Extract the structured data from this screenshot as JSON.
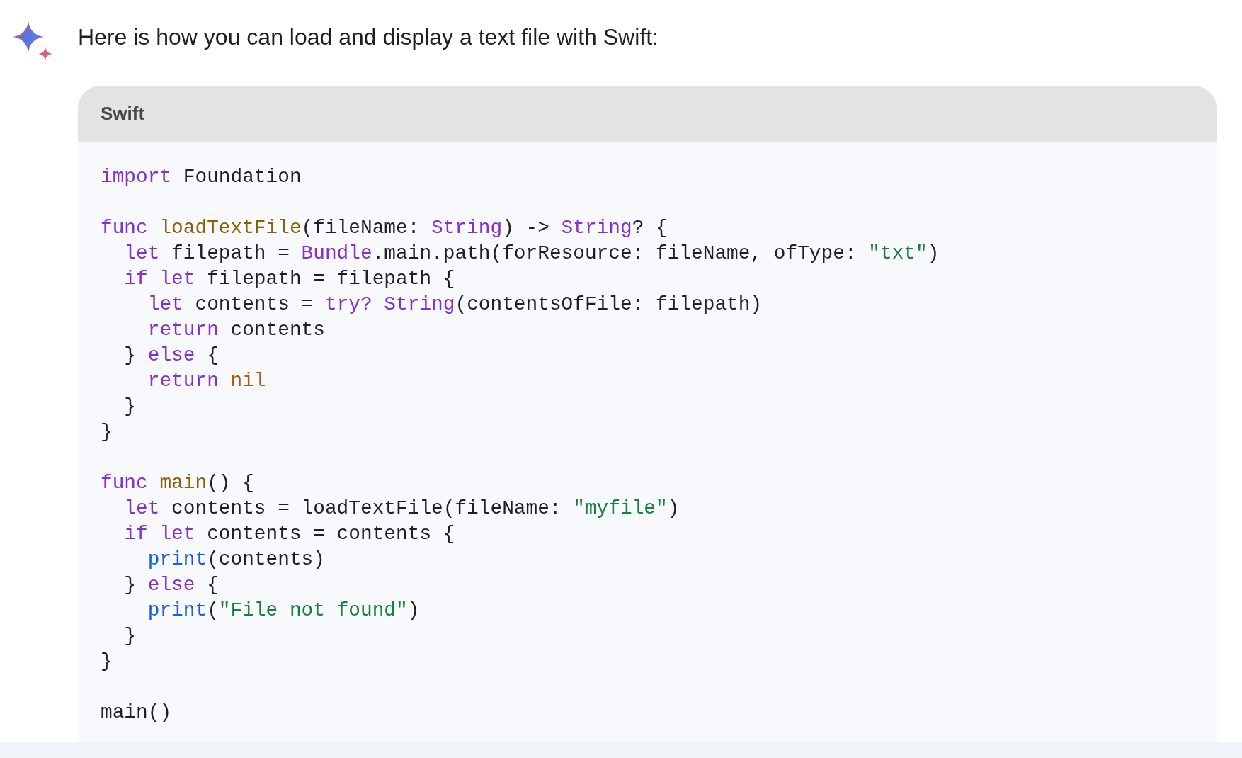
{
  "response": {
    "intro": "Here is how you can load and display a text file with Swift:"
  },
  "code_block": {
    "language": "Swift",
    "lines": [
      {
        "kind": "code",
        "tokens": [
          {
            "kind": "keyword",
            "text": "import"
          },
          {
            "kind": "plain",
            "text": " Foundation"
          }
        ]
      },
      {
        "kind": "blank"
      },
      {
        "kind": "code",
        "tokens": [
          {
            "kind": "keyword",
            "text": "func "
          },
          {
            "kind": "function",
            "text": "loadTextFile"
          },
          {
            "kind": "plain",
            "text": "(fileName: "
          },
          {
            "kind": "type",
            "text": "String"
          },
          {
            "kind": "plain",
            "text": ") -> "
          },
          {
            "kind": "type",
            "text": "String"
          },
          {
            "kind": "plain",
            "text": "? {"
          }
        ]
      },
      {
        "kind": "code",
        "tokens": [
          {
            "kind": "keyword",
            "text": "  let"
          },
          {
            "kind": "plain",
            "text": " filepath = "
          },
          {
            "kind": "type",
            "text": "Bundle"
          },
          {
            "kind": "plain",
            "text": ".main.path(forResource: fileName, ofType: "
          },
          {
            "kind": "string",
            "text": "\"txt\""
          },
          {
            "kind": "plain",
            "text": ")"
          }
        ]
      },
      {
        "kind": "code",
        "tokens": [
          {
            "kind": "keyword",
            "text": "  if let"
          },
          {
            "kind": "plain",
            "text": " filepath = filepath {"
          }
        ]
      },
      {
        "kind": "code",
        "tokens": [
          {
            "kind": "keyword",
            "text": "    let"
          },
          {
            "kind": "plain",
            "text": " contents = "
          },
          {
            "kind": "keyword",
            "text": "try? "
          },
          {
            "kind": "type",
            "text": "String"
          },
          {
            "kind": "plain",
            "text": "(contentsOfFile: filepath)"
          }
        ]
      },
      {
        "kind": "code",
        "tokens": [
          {
            "kind": "keyword",
            "text": "    return"
          },
          {
            "kind": "plain",
            "text": " contents"
          }
        ]
      },
      {
        "kind": "code",
        "tokens": [
          {
            "kind": "plain",
            "text": "  } "
          },
          {
            "kind": "keyword",
            "text": "else"
          },
          {
            "kind": "plain",
            "text": " {"
          }
        ]
      },
      {
        "kind": "code",
        "tokens": [
          {
            "kind": "keyword",
            "text": "    return "
          },
          {
            "kind": "literal",
            "text": "nil"
          }
        ]
      },
      {
        "kind": "code",
        "tokens": [
          {
            "kind": "plain",
            "text": "  }"
          }
        ]
      },
      {
        "kind": "code",
        "tokens": [
          {
            "kind": "plain",
            "text": "}"
          }
        ]
      },
      {
        "kind": "blank"
      },
      {
        "kind": "code",
        "tokens": [
          {
            "kind": "keyword",
            "text": "func "
          },
          {
            "kind": "function",
            "text": "main"
          },
          {
            "kind": "plain",
            "text": "() {"
          }
        ]
      },
      {
        "kind": "code",
        "tokens": [
          {
            "kind": "keyword",
            "text": "  let"
          },
          {
            "kind": "plain",
            "text": " contents = loadTextFile(fileName: "
          },
          {
            "kind": "string",
            "text": "\"myfile\""
          },
          {
            "kind": "plain",
            "text": ")"
          }
        ]
      },
      {
        "kind": "code",
        "tokens": [
          {
            "kind": "keyword",
            "text": "  if let"
          },
          {
            "kind": "plain",
            "text": " contents = contents {"
          }
        ]
      },
      {
        "kind": "code",
        "tokens": [
          {
            "kind": "builtin",
            "text": "    print"
          },
          {
            "kind": "plain",
            "text": "(contents)"
          }
        ]
      },
      {
        "kind": "code",
        "tokens": [
          {
            "kind": "plain",
            "text": "  } "
          },
          {
            "kind": "keyword",
            "text": "else"
          },
          {
            "kind": "plain",
            "text": " {"
          }
        ]
      },
      {
        "kind": "code",
        "tokens": [
          {
            "kind": "builtin",
            "text": "    print"
          },
          {
            "kind": "plain",
            "text": "("
          },
          {
            "kind": "string",
            "text": "\"File not found\""
          },
          {
            "kind": "plain",
            "text": ")"
          }
        ]
      },
      {
        "kind": "code",
        "tokens": [
          {
            "kind": "plain",
            "text": "  }"
          }
        ]
      },
      {
        "kind": "code",
        "tokens": [
          {
            "kind": "plain",
            "text": "}"
          }
        ]
      },
      {
        "kind": "blank"
      },
      {
        "kind": "code",
        "tokens": [
          {
            "kind": "plain",
            "text": "main()"
          }
        ]
      }
    ]
  }
}
